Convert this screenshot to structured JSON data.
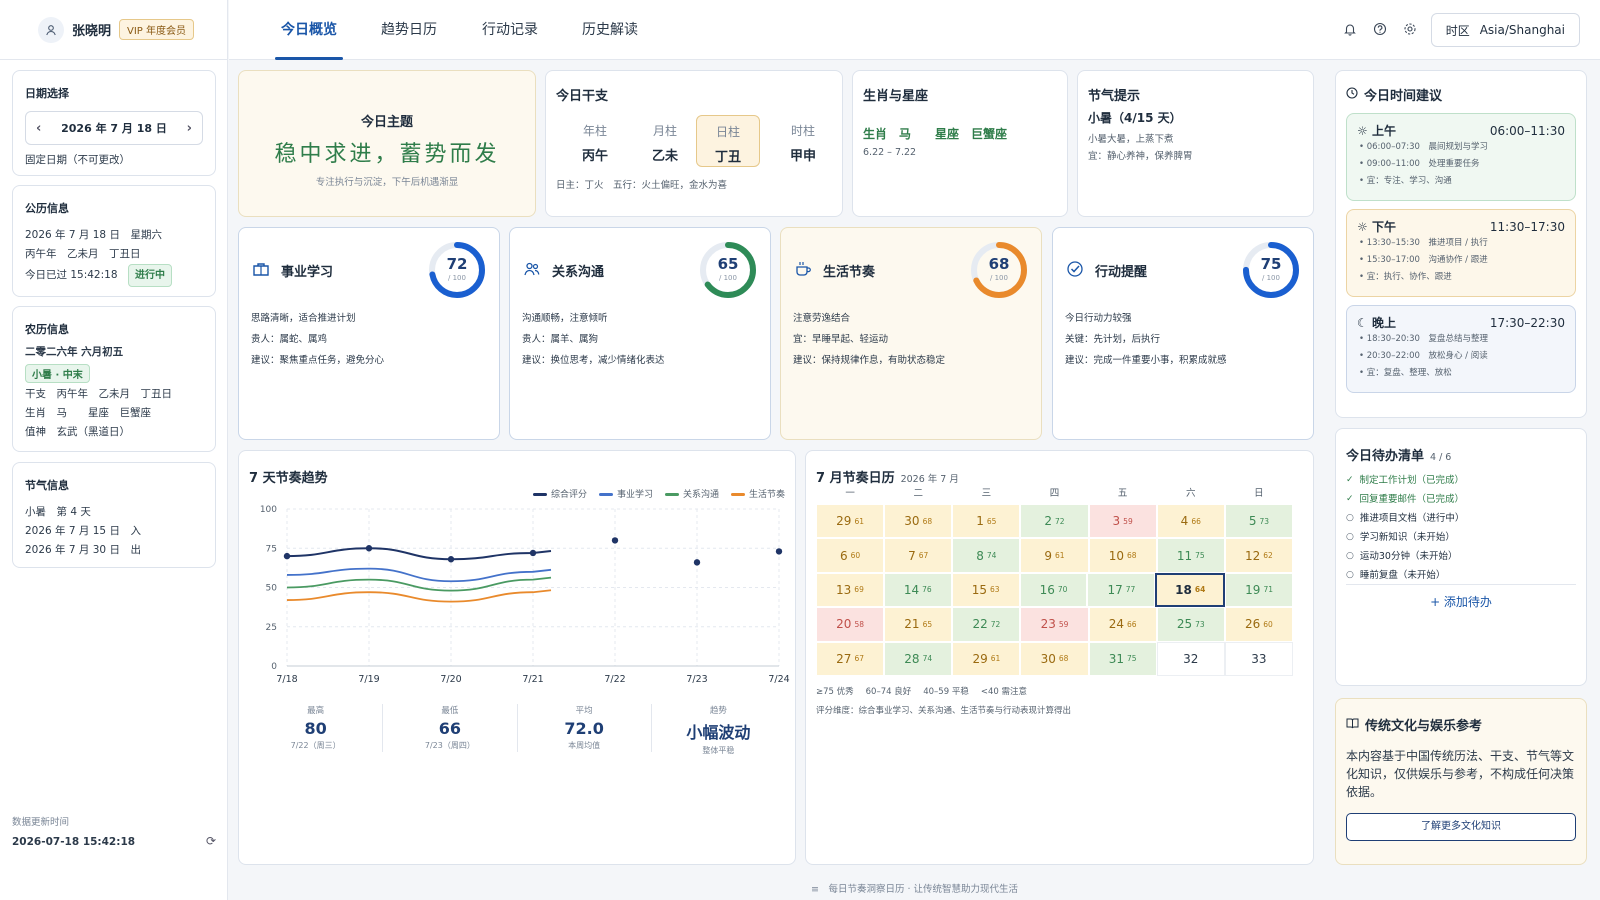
{
  "user": {
    "name": "张晓明",
    "vip": "VIP 年度会员"
  },
  "tabs": [
    "今日概览",
    "趋势日历",
    "行动记录",
    "历史解读"
  ],
  "timezone": {
    "label": "时区",
    "value": "Asia/Shanghai"
  },
  "date_select": {
    "title": "日期选择",
    "date": "2026 年 7 月 18 日",
    "note": "固定日期（不可更改）"
  },
  "solar": {
    "title": "公历信息",
    "line1": "2026 年 7 月 18 日　星期六",
    "line2": "丙午年　乙未月　丁丑日",
    "line3": "今日已过 15:42:18",
    "status": "进行中"
  },
  "lunar": {
    "title": "农历信息",
    "date": "二零二六年 六月初五",
    "tag": "小暑 · 中末",
    "line1": "干支　丙午年　乙未月　丁丑日",
    "line2": "生肖　马　　星座　巨蟹座",
    "line3": "值神　玄武（黑道日）"
  },
  "solar_term": {
    "title": "节气信息",
    "line1": "小暑　第 4 天",
    "line2": "2026 年 7 月 15 日　入",
    "line3": "2026 年 7 月 30 日　出"
  },
  "updated": {
    "label": "数据更新时间",
    "value": "2026-07-18 15:42:18"
  },
  "theme": {
    "title": "今日主题",
    "main": "稳中求进，蓄势而发",
    "sub": "专注执行与沉淀，下午后机遇渐显"
  },
  "ganzhi": {
    "title": "今日干支",
    "cols": [
      {
        "k": "年柱",
        "v": "丙午"
      },
      {
        "k": "月柱",
        "v": "乙未"
      },
      {
        "k": "日柱",
        "v": "丁丑"
      },
      {
        "k": "时柱",
        "v": "甲申"
      }
    ],
    "note": "日主：丁火　五行：火土偏旺，金水为喜"
  },
  "zodiac": {
    "title": "生肖与星座",
    "text": "生肖　马　　星座　巨蟹座",
    "range": "6.22 – 7.22"
  },
  "term_tip": {
    "title": "节气提示",
    "head": "小暑（4/15 天）",
    "line1": "小暑大暑，上蒸下煮",
    "line2": "宜：静心养神，保养脾胃"
  },
  "scores": [
    {
      "title": "事业学习",
      "value": 72,
      "den": "/ 100",
      "color": "#1a5fd0",
      "l1": "思路清晰，适合推进计划",
      "l2": "贵人：属蛇、属鸡",
      "l3": "建议：聚焦重点任务，避免分心"
    },
    {
      "title": "关系沟通",
      "value": 65,
      "den": "/ 100",
      "color": "#2e8b57",
      "l1": "沟通顺畅，注意倾听",
      "l2": "贵人：属羊、属狗",
      "l3": "建议：换位思考，减少情绪化表达"
    },
    {
      "title": "生活节奏",
      "value": 68,
      "den": "/ 100",
      "color": "#e98a2c",
      "l1": "注意劳逸结合",
      "l2": "宜：早睡早起、轻运动",
      "l3": "建议：保持规律作息，有助状态稳定"
    },
    {
      "title": "行动提醒",
      "value": 75,
      "den": "/ 100",
      "color": "#1a5fd0",
      "l1": "今日行动力较强",
      "l2": "关键：先计划，后执行",
      "l3": "建议：完成一件重要小事，积累成就感"
    }
  ],
  "trend": {
    "title": "7 天节奏趋势",
    "stats": [
      {
        "k": "最高",
        "v": "80",
        "s": "7/22（周三）"
      },
      {
        "k": "最低",
        "v": "66",
        "s": "7/23（周四）"
      },
      {
        "k": "平均",
        "v": "72.0",
        "s": "本周均值"
      },
      {
        "k": "趋势",
        "v": "小幅波动",
        "s": "整体平稳"
      }
    ]
  },
  "chart_data": {
    "type": "line",
    "x": [
      "7/18",
      "7/19",
      "7/20",
      "7/21",
      "7/22",
      "7/23",
      "7/24"
    ],
    "ylim": [
      0,
      100
    ],
    "yticks": [
      "0",
      "25",
      "50",
      "75",
      "100"
    ],
    "grid": true,
    "legend": "top-right",
    "series": [
      {
        "name": "综合评分",
        "color": "#1f3466",
        "values": [
          70,
          75,
          68,
          72,
          80,
          66,
          73
        ]
      },
      {
        "name": "事业学习",
        "color": "#4472ca",
        "values": [
          58,
          62,
          54,
          60,
          null,
          null,
          null
        ]
      },
      {
        "name": "关系沟通",
        "color": "#4a9a62",
        "values": [
          50,
          55,
          48,
          55,
          null,
          null,
          null
        ]
      },
      {
        "name": "生活节奏",
        "color": "#e98a2c",
        "values": [
          42,
          47,
          41,
          47,
          null,
          null,
          null
        ]
      }
    ]
  },
  "calendar": {
    "title": "7 月节奏日历",
    "subtitle": "2026 年 7 月",
    "weekdays": [
      "一",
      "二",
      "三",
      "四",
      "五",
      "六",
      "日"
    ],
    "cells": [
      [
        {
          "d": "29",
          "s": "61",
          "c": "y"
        },
        {
          "d": "30",
          "s": "68",
          "c": "y"
        },
        {
          "d": "1",
          "s": "65",
          "c": "y"
        },
        {
          "d": "2",
          "s": "72",
          "c": "g"
        },
        {
          "d": "3",
          "s": "59",
          "c": "r"
        },
        {
          "d": "4",
          "s": "66",
          "c": "y"
        },
        {
          "d": "5",
          "s": "73",
          "c": "g"
        }
      ],
      [
        {
          "d": "6",
          "s": "60",
          "c": "y"
        },
        {
          "d": "7",
          "s": "67",
          "c": "y"
        },
        {
          "d": "8",
          "s": "74",
          "c": "g"
        },
        {
          "d": "9",
          "s": "61",
          "c": "y"
        },
        {
          "d": "10",
          "s": "68",
          "c": "y"
        },
        {
          "d": "11",
          "s": "75",
          "c": "g"
        },
        {
          "d": "12",
          "s": "62",
          "c": "y"
        }
      ],
      [
        {
          "d": "13",
          "s": "69",
          "c": "y"
        },
        {
          "d": "14",
          "s": "76",
          "c": "g"
        },
        {
          "d": "15",
          "s": "63",
          "c": "y"
        },
        {
          "d": "16",
          "s": "70",
          "c": "g"
        },
        {
          "d": "17",
          "s": "77",
          "c": "g"
        },
        {
          "d": "18",
          "s": "64",
          "c": "today"
        },
        {
          "d": "19",
          "s": "71",
          "c": "g"
        }
      ],
      [
        {
          "d": "20",
          "s": "58",
          "c": "r"
        },
        {
          "d": "21",
          "s": "65",
          "c": "y"
        },
        {
          "d": "22",
          "s": "72",
          "c": "g"
        },
        {
          "d": "23",
          "s": "59",
          "c": "r"
        },
        {
          "d": "24",
          "s": "66",
          "c": "y"
        },
        {
          "d": "25",
          "s": "73",
          "c": "g"
        },
        {
          "d": "26",
          "s": "60",
          "c": "y"
        }
      ],
      [
        {
          "d": "27",
          "s": "67",
          "c": "y"
        },
        {
          "d": "28",
          "s": "74",
          "c": "g"
        },
        {
          "d": "29",
          "s": "61",
          "c": "y"
        },
        {
          "d": "30",
          "s": "68",
          "c": "y"
        },
        {
          "d": "31",
          "s": "75",
          "c": "g"
        },
        {
          "d": "32",
          "s": "",
          "c": "w"
        },
        {
          "d": "33",
          "s": "",
          "c": "w"
        }
      ]
    ],
    "legend": [
      "≥75 优秀",
      "60–74 良好",
      "40–59 平稳",
      "<40 需注意"
    ],
    "note": "评分维度：综合事业学习、关系沟通、生活节奏与行动表现计算得出"
  },
  "time_advice": {
    "title": "今日时间建议",
    "slots": [
      {
        "name": "上午",
        "time": "06:00–11:30",
        "lines": [
          "06:00–07:30　晨间规划与学习",
          "09:00–11:00　处理重要任务",
          "宜：专注、学习、沟通"
        ]
      },
      {
        "name": "下午",
        "time": "11:30–17:30",
        "lines": [
          "13:30–15:30　推进项目 / 执行",
          "15:30–17:00　沟通协作 / 跟进",
          "宜：执行、协作、跟进"
        ]
      },
      {
        "name": "晚上",
        "time": "17:30–22:30",
        "lines": [
          "18:30–20:30　复盘总结与整理",
          "20:30–22:00　放松身心 / 阅读",
          "宜：复盘、整理、放松"
        ]
      }
    ]
  },
  "todo": {
    "title": "今日待办清单",
    "count": "4 / 6",
    "items": [
      {
        "t": "制定工作计划（已完成）",
        "done": true
      },
      {
        "t": "回复重要邮件（已完成）",
        "done": true
      },
      {
        "t": "推进项目文档（进行中）",
        "done": false
      },
      {
        "t": "学习新知识（未开始）",
        "done": false
      },
      {
        "t": "运动30分钟（未开始）",
        "done": false
      },
      {
        "t": "睡前复盘（未开始）",
        "done": false
      }
    ],
    "add": "+ 添加待办"
  },
  "culture": {
    "title": "传统文化与娱乐参考",
    "text": "本内容基于中国传统历法、干支、节气等文化知识，仅供娱乐与参考，不构成任何决策依据。",
    "button": "了解更多文化知识"
  },
  "footer": "每日节奏洞察日历 · 让传统智慧助力现代生活"
}
